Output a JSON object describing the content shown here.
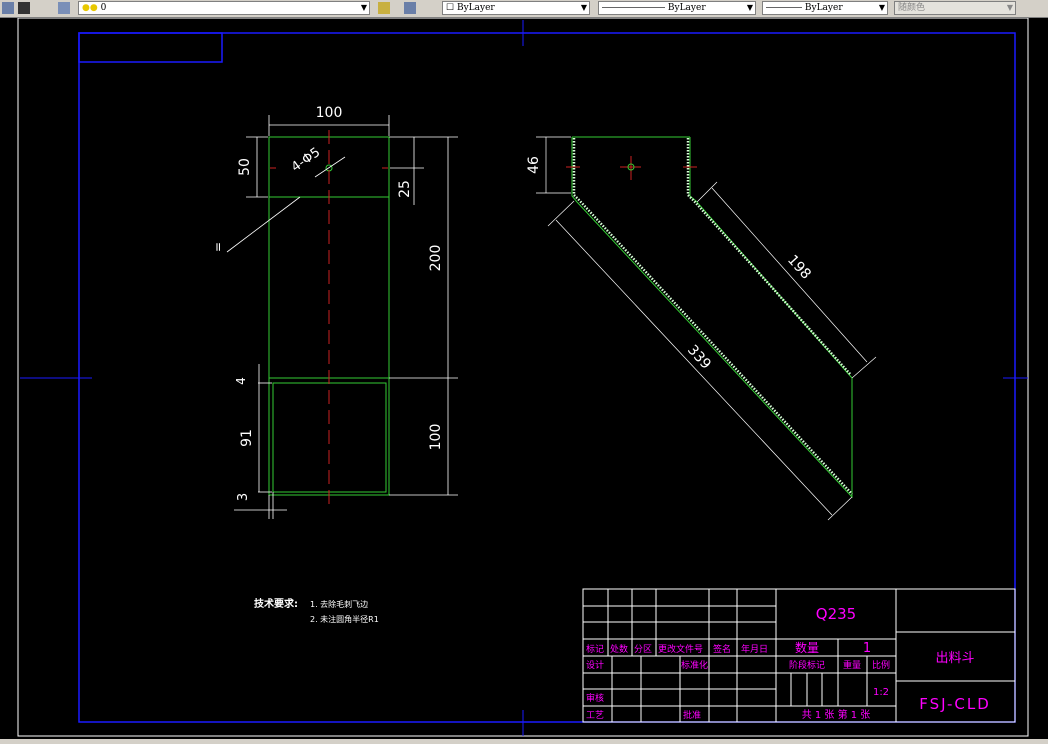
{
  "toolbar": {
    "layer_value": "0",
    "color_value": "ByLayer",
    "linetype_value": "ByLayer",
    "lineweight_value": "ByLayer",
    "plotstyle_value": "随颜色"
  },
  "drawing": {
    "colors": {
      "geometry": "#33cc33",
      "dimension": "#ffffff",
      "centerline": "#cc2222",
      "frame": "#1a1aff",
      "titletext": "#ff00ff"
    },
    "front_view": {
      "dim_width": "100",
      "dim_flange": "50",
      "dim_hole_offset": "25",
      "dim_upper": "200",
      "dim_lower": "100",
      "dim_gap_top": "4",
      "dim_inner": "91",
      "dim_gap_bottom": "3",
      "hole_label": "4-Φ5",
      "leader_mark": "="
    },
    "side_view": {
      "dim_height": "46",
      "dim_short": "198",
      "dim_long": "339"
    },
    "notes": {
      "title": "技术要求:",
      "items": [
        "1. 去除毛刺飞边",
        "2. 未注圆角半径R1"
      ]
    }
  },
  "title_block": {
    "material": "Q235",
    "headers": [
      "标记",
      "处数",
      "分区",
      "更改文件号",
      "签名",
      "年月日"
    ],
    "design": "设计",
    "standardize": "标准化",
    "review": "审核",
    "process": "工艺",
    "approve": "批准",
    "quantity_label": "数量",
    "quantity_value": "1",
    "stage_label": "阶段标记",
    "weight_label": "重量",
    "scale_label": "比例",
    "scale_value": "1:2",
    "sheets": "共 1 张 第 1 张",
    "part_name": "出料斗",
    "drawing_number": "FSJ-CLD"
  }
}
